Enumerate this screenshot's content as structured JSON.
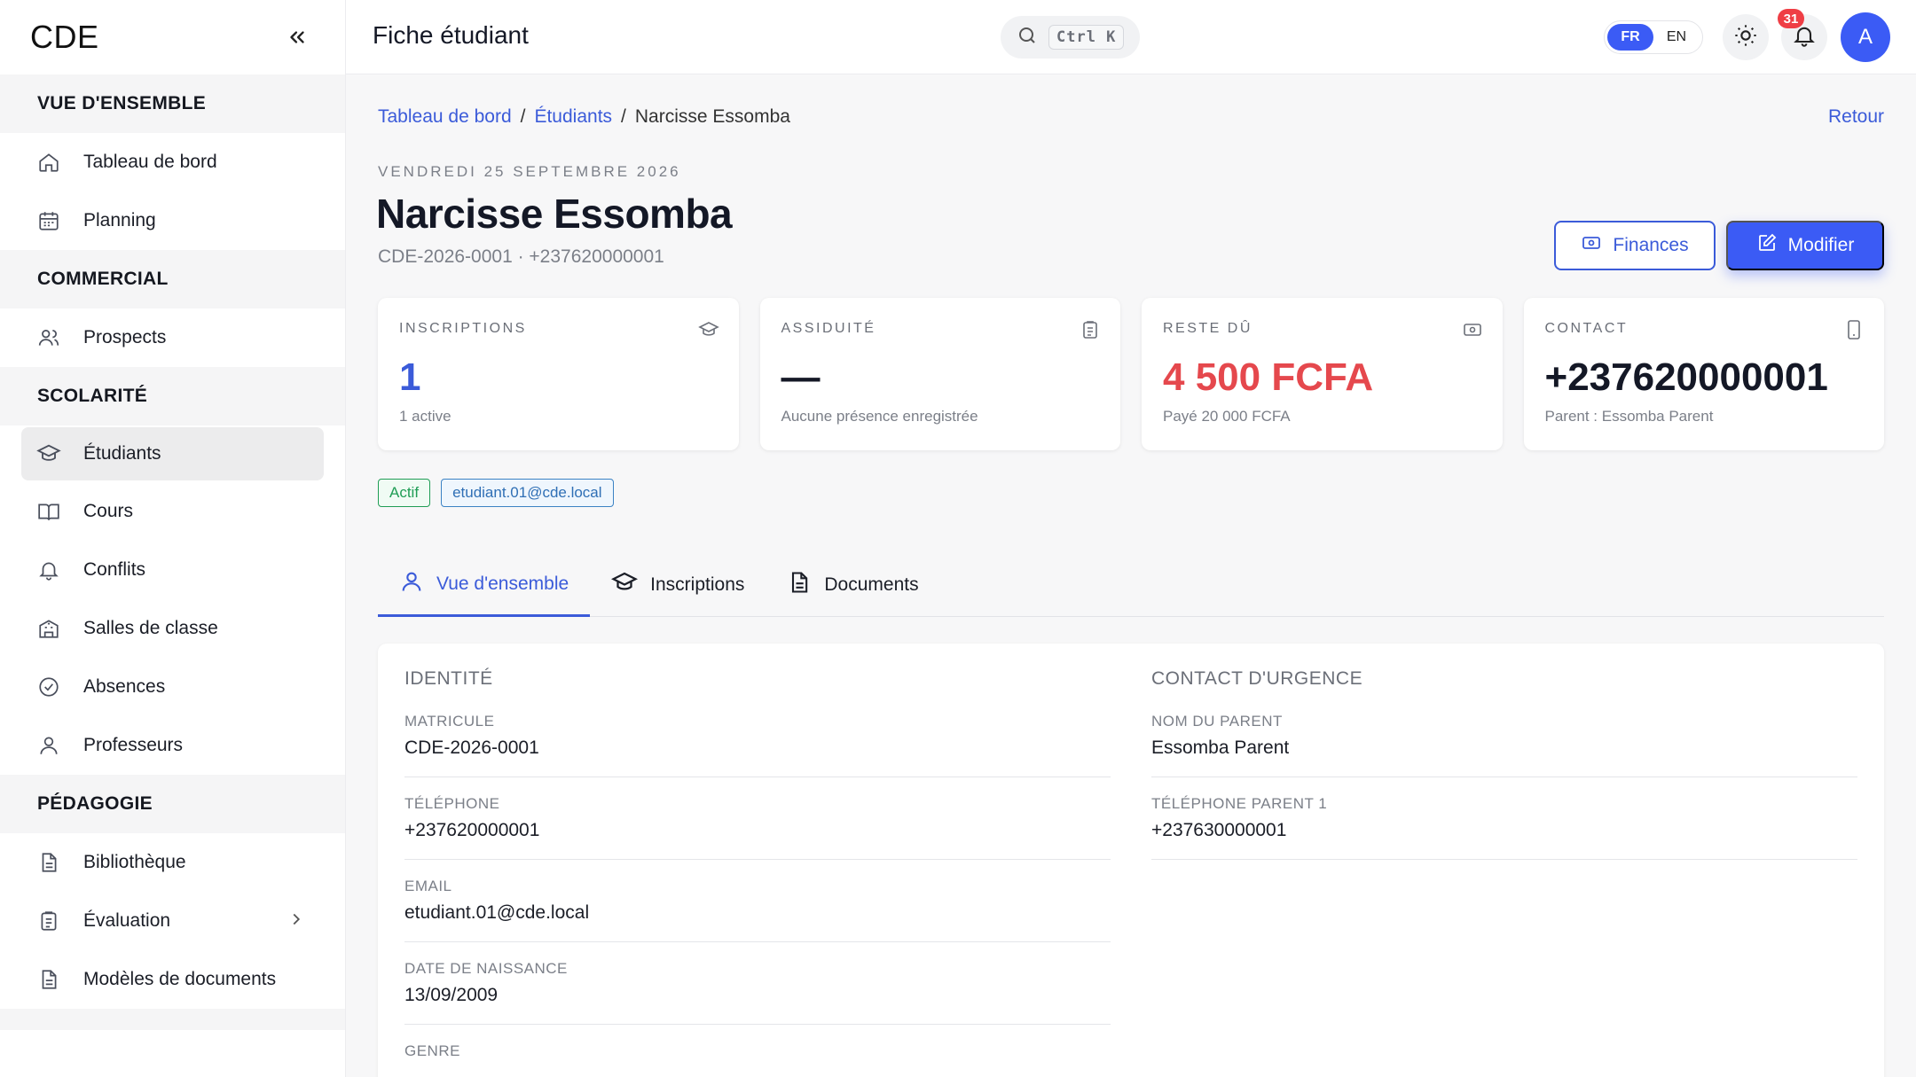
{
  "app": {
    "brand": "CDE",
    "page_title": "Fiche étudiant"
  },
  "sidebar": {
    "sections": [
      {
        "title": "VUE D'ENSEMBLE",
        "items": [
          {
            "label": "Tableau de bord",
            "icon": "home-icon"
          },
          {
            "label": "Planning",
            "icon": "calendar-icon"
          }
        ]
      },
      {
        "title": "COMMERCIAL",
        "items": [
          {
            "label": "Prospects",
            "icon": "users-icon"
          }
        ]
      },
      {
        "title": "SCOLARITÉ",
        "items": [
          {
            "label": "Étudiants",
            "icon": "graduation-cap-icon",
            "active": true
          },
          {
            "label": "Cours",
            "icon": "book-icon"
          },
          {
            "label": "Conflits",
            "icon": "bell-icon"
          },
          {
            "label": "Salles de classe",
            "icon": "building-icon"
          },
          {
            "label": "Absences",
            "icon": "check-circle-icon"
          },
          {
            "label": "Professeurs",
            "icon": "user-icon"
          }
        ]
      },
      {
        "title": "PÉDAGOGIE",
        "items": [
          {
            "label": "Bibliothèque",
            "icon": "file-icon"
          },
          {
            "label": "Évaluation",
            "icon": "clipboard-icon",
            "has_submenu": true
          },
          {
            "label": "Modèles de documents",
            "icon": "file-icon"
          }
        ]
      }
    ]
  },
  "topbar": {
    "search_shortcut": "Ctrl K",
    "lang_active": "FR",
    "lang_other": "EN",
    "notifications_count": "31",
    "avatar_initial": "A"
  },
  "breadcrumb": {
    "home": "Tableau de bord",
    "section": "Étudiants",
    "current": "Narcisse Essomba"
  },
  "back_label": "Retour",
  "header": {
    "date": "VENDREDI 25 SEPTEMBRE 2026",
    "name": "Narcisse Essomba",
    "subtitle": "CDE-2026-0001 · +237620000001",
    "finances_label": "Finances",
    "edit_label": "Modifier"
  },
  "stats": [
    {
      "label": "INSCRIPTIONS",
      "value": "1",
      "note": "1 active",
      "color": "#3b5bd9",
      "icon": "graduation-cap-icon"
    },
    {
      "label": "ASSIDUITÉ",
      "value": "—",
      "note": "Aucune présence enregistrée",
      "color": "#141826",
      "icon": "clipboard-icon"
    },
    {
      "label": "RESTE DÛ",
      "value": "4 500 FCFA",
      "note": "Payé 20 000 FCFA",
      "color": "#e5484d",
      "icon": "money-icon"
    },
    {
      "label": "CONTACT",
      "value": "+237620000001",
      "note": "Parent : Essomba Parent",
      "color": "#141826",
      "icon": "phone-icon"
    }
  ],
  "tags": {
    "status": "Actif",
    "email": "etudiant.01@cde.local"
  },
  "tabs": [
    {
      "label": "Vue d'ensemble",
      "icon": "user-icon",
      "active": true
    },
    {
      "label": "Inscriptions",
      "icon": "graduation-cap-icon"
    },
    {
      "label": "Documents",
      "icon": "file-icon"
    }
  ],
  "identity": {
    "title": "IDENTITÉ",
    "fields": [
      {
        "label": "MATRICULE",
        "value": "CDE-2026-0001"
      },
      {
        "label": "TÉLÉPHONE",
        "value": "+237620000001"
      },
      {
        "label": "EMAIL",
        "value": "etudiant.01@cde.local"
      },
      {
        "label": "DATE DE NAISSANCE",
        "value": "13/09/2009"
      },
      {
        "label": "GENRE",
        "value": ""
      }
    ]
  },
  "emergency": {
    "title": "CONTACT D'URGENCE",
    "fields": [
      {
        "label": "NOM DU PARENT",
        "value": "Essomba Parent"
      },
      {
        "label": "TÉLÉPHONE PARENT 1",
        "value": "+237630000001"
      }
    ]
  }
}
